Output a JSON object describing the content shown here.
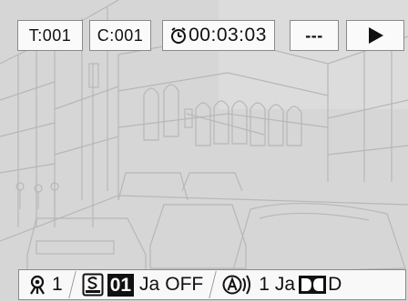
{
  "osd_top": {
    "title_label": "T:001",
    "chapter_label": "C:001",
    "elapsed_time": "00:03:03",
    "repeat_mode": "---",
    "status_icon": "play-icon"
  },
  "osd_bottom": {
    "angle_icon": "angle-icon",
    "angle_value": "1",
    "subtitle_icon": "subtitle-icon",
    "subtitle_track": "01",
    "subtitle_language": "Ja",
    "subtitle_state": "OFF",
    "audio_icon": "audio-icon",
    "audio_track": "1",
    "audio_language": "Ja",
    "audio_format_icon": "dolby-icon",
    "audio_format": "D"
  },
  "colors": {
    "osd_box_bg": "#fafafa",
    "osd_border": "#8a8a8a",
    "scene_bg": "#d6d6d6",
    "scene_lines": "#b7b7b7"
  }
}
